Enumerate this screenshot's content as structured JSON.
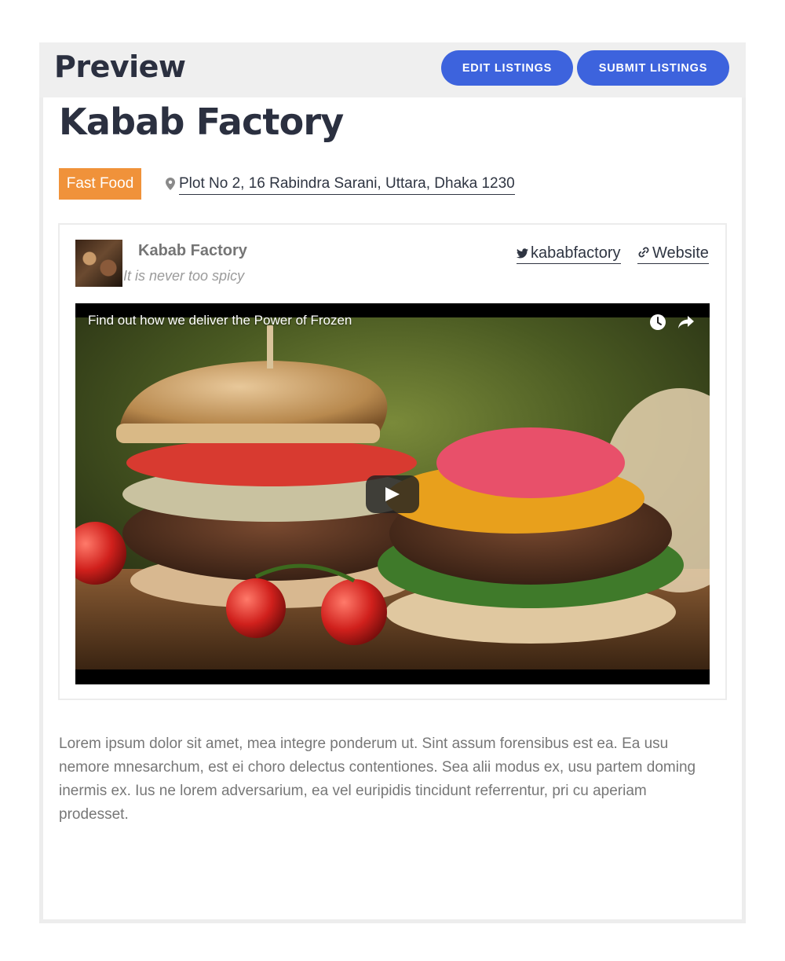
{
  "header": {
    "title": "Preview",
    "edit_label": "EDIT LISTINGS",
    "submit_label": "SUBMIT LISTINGS"
  },
  "listing": {
    "title": "Kabab Factory",
    "category": "Fast Food",
    "address": "Plot No 2, 16 Rabindra Sarani, Uttara, Dhaka 1230",
    "business_name": "Kabab Factory",
    "tagline": "It is never too spicy",
    "twitter": "kababfactory",
    "website_label": "Website",
    "video_title": "Find out how we deliver the Power of Frozen",
    "description": "Lorem ipsum dolor sit amet, mea integre ponderum ut. Sint assum forensibus est ea. Ea usu nemore mnesarchum, est ei choro delectus contentiones. Sea alii modus ex, usu partem doming inermis ex. Ius ne lorem adversarium, ea vel euripidis tincidunt referrentur, pri cu aperiam prodesset."
  },
  "colors": {
    "accent": "#3d63dd",
    "badge": "#f0923a",
    "heading": "#2b3040"
  }
}
